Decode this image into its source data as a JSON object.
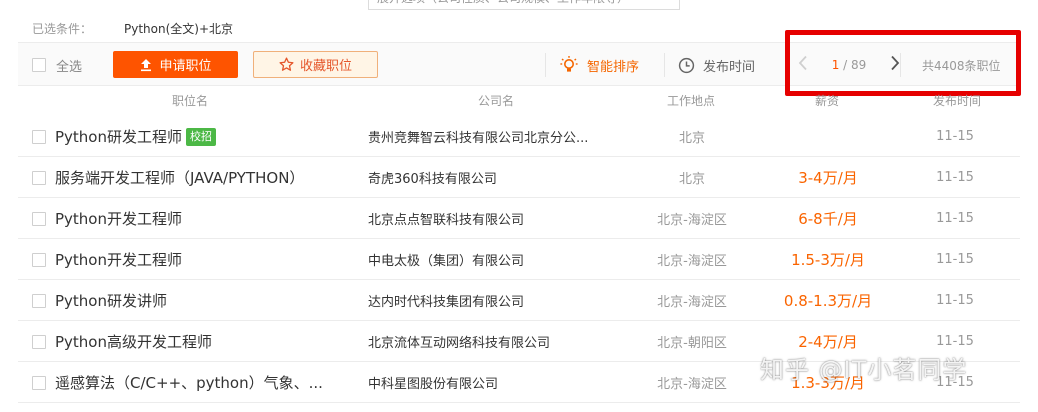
{
  "top_clip": "展开选项（公司性质、公司规模、工作年限等）",
  "conditions": {
    "label": "已选条件：",
    "value": "Python(全文)+北京"
  },
  "toolbar": {
    "select_all": "全选",
    "apply": "申请职位",
    "favorite": "收藏职位",
    "sort_smart": "智能排序",
    "sort_time": "发布时间",
    "page_current": "1",
    "page_total": "/ 89",
    "total": "共4408条职位"
  },
  "columns": {
    "title": "职位名",
    "company": "公司名",
    "location": "工作地点",
    "salary": "薪资",
    "date": "发布时间"
  },
  "jobs": [
    {
      "title": "Python研发工程师",
      "badge": "校招",
      "company": "贵州竞舞智云科技有限公司北京分公...",
      "location": "北京",
      "salary": "",
      "date": "11-15"
    },
    {
      "title": "服务端开发工程师（JAVA/PYTHON）",
      "badge": "",
      "company": "奇虎360科技有限公司",
      "location": "北京",
      "salary": "3-4万/月",
      "date": "11-15"
    },
    {
      "title": "Python开发工程师",
      "badge": "",
      "company": "北京点点智联科技有限公司",
      "location": "北京-海淀区",
      "salary": "6-8千/月",
      "date": "11-15"
    },
    {
      "title": "Python开发工程师",
      "badge": "",
      "company": "中电太极（集团）有限公司",
      "location": "北京-海淀区",
      "salary": "1.5-3万/月",
      "date": "11-15"
    },
    {
      "title": "Python研发讲师",
      "badge": "",
      "company": "达内时代科技集团有限公司",
      "location": "北京-海淀区",
      "salary": "0.8-1.3万/月",
      "date": "11-15"
    },
    {
      "title": "Python高级开发工程师",
      "badge": "",
      "company": "北京流体互动网络科技有限公司",
      "location": "北京-朝阳区",
      "salary": "2-4万/月",
      "date": "11-15"
    },
    {
      "title": "遥感算法（C/C++、python）气象、...",
      "badge": "",
      "company": "中科星图股份有限公司",
      "location": "北京-海淀区",
      "salary": "1.3-3万/月",
      "date": "11-15"
    }
  ],
  "watermark": "知乎 @IT小茗同学",
  "colors": {
    "accent": "#fe5400",
    "salary": "#fa6400",
    "badge": "#4cb846",
    "highlight": "#e60000"
  }
}
